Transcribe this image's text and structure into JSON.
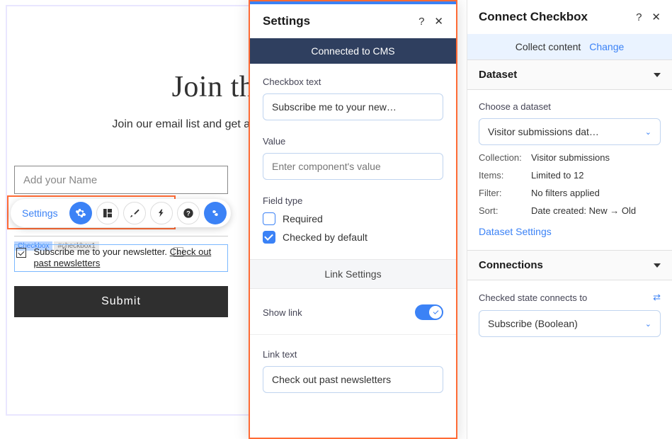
{
  "canvas": {
    "heading": "Join the",
    "subheading": "Join our email list and get access to specia",
    "name_placeholder": "Add your Name",
    "checkbox_tag_active": "Checkbox",
    "checkbox_tag_id": "#checkbox1",
    "checkbox_text": "Subscribe me to your newsletter.",
    "checkbox_link": "Check out past newsletters",
    "submit": "Submit"
  },
  "toolbar": {
    "settings_label": "Settings"
  },
  "settings_panel": {
    "title": "Settings",
    "cms_banner": "Connected to CMS",
    "checkbox_text_label": "Checkbox text",
    "checkbox_text_value": "Subscribe me to your new…",
    "value_label": "Value",
    "value_placeholder": "Enter component's value",
    "field_type_label": "Field type",
    "required_label": "Required",
    "checked_default_label": "Checked by default",
    "link_settings_label": "Link Settings",
    "show_link_label": "Show link",
    "link_text_label": "Link text",
    "link_text_value": "Check out past newsletters"
  },
  "connect_panel": {
    "title": "Connect Checkbox",
    "collect_label": "Collect content",
    "change_label": "Change",
    "dataset_section": "Dataset",
    "choose_dataset_label": "Choose a dataset",
    "dataset_value": "Visitor submissions dat…",
    "collection_label": "Collection:",
    "collection_value": "Visitor submissions",
    "items_label": "Items:",
    "items_value": "Limited to 12",
    "filter_label": "Filter:",
    "filter_value": "No filters applied",
    "sort_label": "Sort:",
    "sort_value": "Date created: New → Old",
    "dataset_settings_link": "Dataset Settings",
    "connections_section": "Connections",
    "checked_state_label": "Checked state connects to",
    "checked_state_value": "Subscribe (Boolean)"
  }
}
